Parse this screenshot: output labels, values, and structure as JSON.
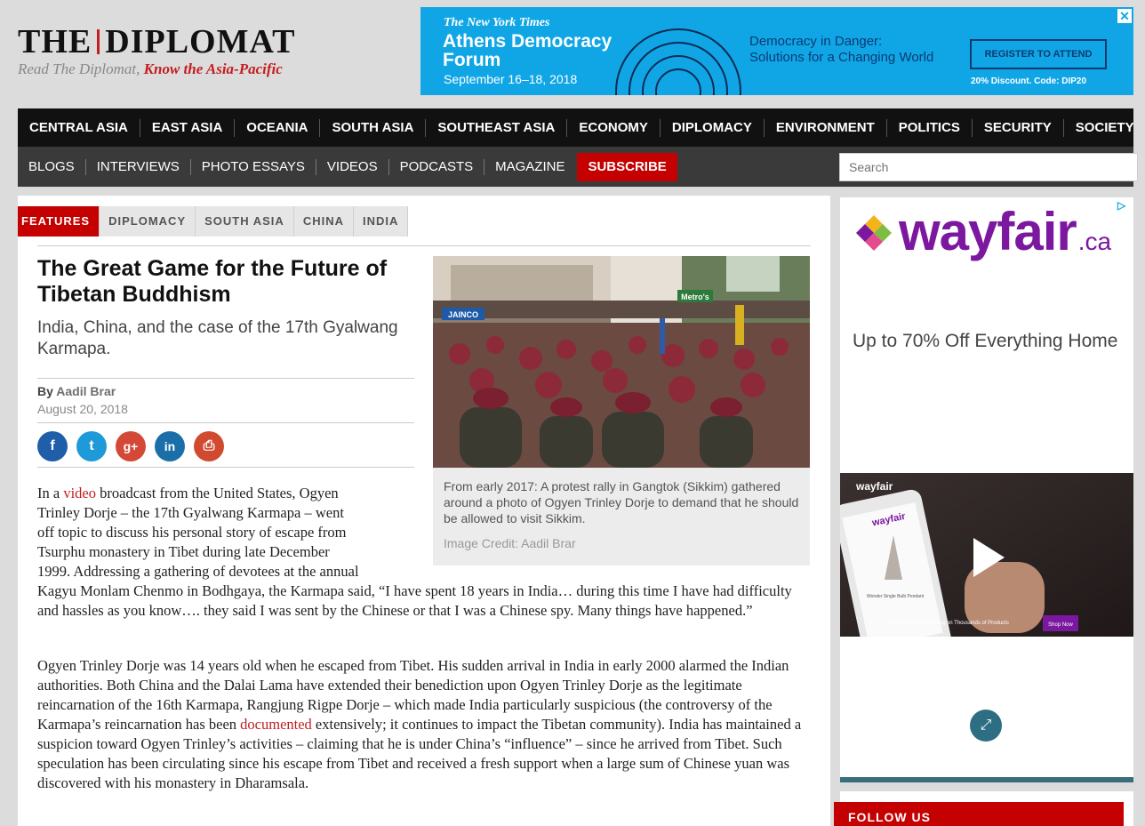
{
  "logo": {
    "name_part1": "THE",
    "name_part2": "DIPLOMAT",
    "tagline_plain": "Read The Diplomat, ",
    "tagline_bold": "Know the Asia-Pacific"
  },
  "top_ad": {
    "brand": "The New York Times",
    "event": "Athens Democracy Forum",
    "dates": "September 16–18, 2018",
    "slogan_line1": "Democracy in Danger:",
    "slogan_line2": "Solutions for a Changing World",
    "cta": "REGISTER TO ATTEND",
    "discount": "20% Discount.",
    "code": "Code: DIP20",
    "close": "✕",
    "bg_color": "#10a6e6"
  },
  "nav_primary": [
    "CENTRAL ASIA",
    "EAST ASIA",
    "OCEANIA",
    "SOUTH ASIA",
    "SOUTHEAST ASIA",
    "ECONOMY",
    "DIPLOMACY",
    "ENVIRONMENT",
    "POLITICS",
    "SECURITY",
    "SOCIETY"
  ],
  "nav_secondary": [
    "BLOGS",
    "INTERVIEWS",
    "PHOTO ESSAYS",
    "VIDEOS",
    "PODCASTS",
    "MAGAZINE"
  ],
  "subscribe_label": "SUBSCRIBE",
  "search_placeholder": "Search",
  "tabs": [
    "FEATURES",
    "DIPLOMACY",
    "SOUTH ASIA",
    "CHINA",
    "INDIA"
  ],
  "article": {
    "title": "The Great Game for the Future of Tibetan Buddhism",
    "subtitle": "India, China, and the case of the 17th Gyalwang Karmapa.",
    "by": "By ",
    "author": "Aadil Brar",
    "date": "August 20, 2018",
    "share_icons": [
      "facebook-icon",
      "twitter-icon",
      "google-plus-icon",
      "linkedin-icon",
      "print-icon"
    ],
    "share_glyphs": [
      "f",
      "t",
      "g+",
      "in",
      "⎙"
    ],
    "image_signs": [
      "JAINCO",
      "Metro's"
    ],
    "caption": "From early 2017: A protest rally in Gangtok (Sikkim) gathered around a photo of Ogyen Trinley Dorje to demand that he should be allowed to visit Sikkim.",
    "credit": "Image Credit: Aadil Brar",
    "p1_a": "In a ",
    "p1_link": "video",
    "p1_b": " broadcast from the United States, Ogyen",
    "p1_lines": [
      "Trinley Dorje – the 17th Gyalwang Karmapa – went",
      "off topic to discuss his personal story of escape from",
      "Tsurphu monastery in Tibet during late December",
      "1999. Addressing a gathering of devotees at the annual"
    ],
    "p1_rest": "Kagyu Monlam Chenmo in Bodhgaya, the Karmapa said, “I have spent 18 years in India… during this time I have had difficulty and hassles as you know…. they said I was sent by the Chinese or that I was a Chinese spy. Many things have happened.”",
    "p2_a": "Ogyen Trinley Dorje was 14 years old when he escaped from Tibet. His sudden arrival in India in early 2000 alarmed the Indian authorities. Both China and the Dalai Lama have extended their benediction upon Ogyen Trinley Dorje as the legitimate reincarnation of the 16th Karmapa, Rangjung Rigpe Dorje – which made India particularly suspicious (the controversy of the Karmapa’s reincarnation has been ",
    "p2_link": "documented",
    "p2_b": " extensively; it continues to impact the Tibetan community). India has maintained a suspicion toward Ogyen Trinley’s activities – claiming that he is under China’s “influence” – since he arrived from Tibet. Such speculation has been circulating since his escape from Tibet and received a fresh support when a large sum of Chinese yuan was discovered with his monastery in Dharamsala."
  },
  "side_ad": {
    "logo_word": "wayfair",
    "logo_suffix": ".ca",
    "offer": "Up to 70% Off Everything Home",
    "video_brand": "wayfair",
    "video_phone_logo": "wayfair",
    "video_product": "Wonder Single Bulb Pendant",
    "video_banner": "FAST & FREE Shipping on Thousands of Products",
    "video_shop": "Shop Now",
    "adchoices": "▷",
    "expand": "⤢"
  },
  "follow_us": "FOLLOW US"
}
